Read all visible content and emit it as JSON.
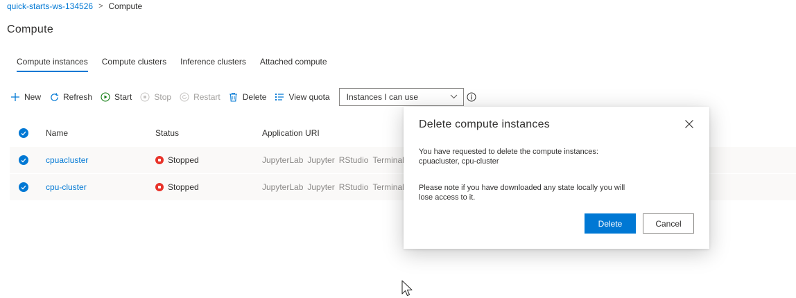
{
  "breadcrumb": {
    "workspace": "quick-starts-ws-134526",
    "separator": ">",
    "current": "Compute"
  },
  "page": {
    "title": "Compute"
  },
  "tabs": [
    {
      "label": "Compute instances",
      "active": true
    },
    {
      "label": "Compute clusters",
      "active": false
    },
    {
      "label": "Inference clusters",
      "active": false
    },
    {
      "label": "Attached compute",
      "active": false
    }
  ],
  "toolbar": {
    "new_label": "New",
    "refresh_label": "Refresh",
    "start_label": "Start",
    "stop_label": "Stop",
    "restart_label": "Restart",
    "delete_label": "Delete",
    "view_quota_label": "View quota",
    "filter_value": "Instances I can use"
  },
  "table": {
    "columns": {
      "name": "Name",
      "status": "Status",
      "uri": "Application URI"
    },
    "rows": [
      {
        "name": "cpuacluster",
        "status": "Stopped",
        "uris": [
          "JupyterLab",
          "Jupyter",
          "RStudio",
          "Terminal"
        ]
      },
      {
        "name": "cpu-cluster",
        "status": "Stopped",
        "uris": [
          "JupyterLab",
          "Jupyter",
          "RStudio",
          "Terminal"
        ]
      }
    ]
  },
  "dialog": {
    "title": "Delete compute instances",
    "message_line1": "You have requested to delete the compute instances:",
    "message_line2": "cpuacluster, cpu-cluster",
    "message_line3": "Please note if you have downloaded any state locally you will",
    "message_line4": "lose access to it.",
    "delete_label": "Delete",
    "cancel_label": "Cancel"
  },
  "colors": {
    "accent": "#0078d4",
    "start_green": "#107c10",
    "stopped_red": "#e8332a",
    "disabled": "#a19f9d"
  }
}
